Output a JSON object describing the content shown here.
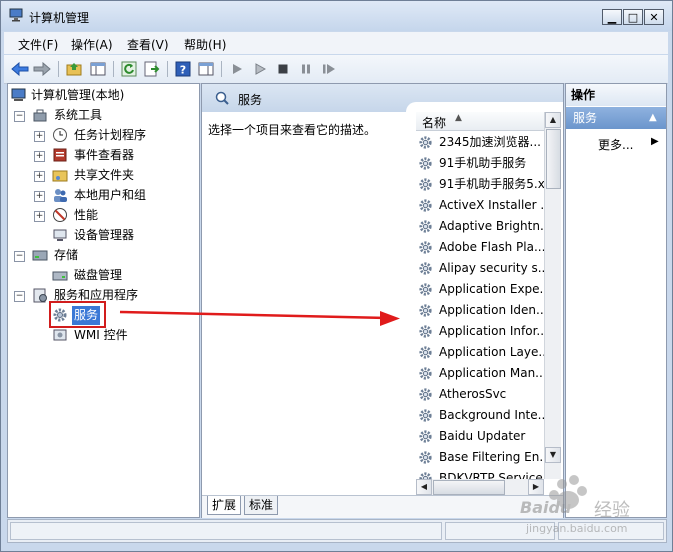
{
  "window": {
    "title": "计算机管理",
    "controls": [
      "minimize",
      "maximize",
      "close"
    ]
  },
  "menu": [
    "文件(F)",
    "操作(A)",
    "查看(V)",
    "帮助(H)"
  ],
  "tree": {
    "root": "计算机管理(本地)",
    "nodes": [
      {
        "label": "系统工具",
        "icon": "tools-icon",
        "expander": "−"
      },
      {
        "label": "任务计划程序",
        "icon": "clock-icon",
        "expander": "+"
      },
      {
        "label": "事件查看器",
        "icon": "event-viewer-icon",
        "expander": "+"
      },
      {
        "label": "共享文件夹",
        "icon": "shared-folder-icon",
        "expander": "+"
      },
      {
        "label": "本地用户和组",
        "icon": "users-icon",
        "expander": "+"
      },
      {
        "label": "性能",
        "icon": "performance-icon",
        "expander": "+"
      },
      {
        "label": "设备管理器",
        "icon": "device-manager-icon",
        "expander": ""
      },
      {
        "label": "存储",
        "icon": "storage-icon",
        "expander": "−"
      },
      {
        "label": "磁盘管理",
        "icon": "disk-icon",
        "expander": ""
      },
      {
        "label": "服务和应用程序",
        "icon": "services-apps-icon",
        "expander": "−"
      },
      {
        "label": "服务",
        "icon": "gear-icon",
        "expander": ""
      },
      {
        "label": "WMI 控件",
        "icon": "wmi-icon",
        "expander": ""
      }
    ]
  },
  "middle": {
    "header_title": "服务",
    "description": "选择一个项目来查看它的描述。",
    "column_name": "名称",
    "services": [
      "2345加速浏览器...",
      "91手机助手服务",
      "91手机助手服务5.x",
      "ActiveX Installer ...",
      "Adaptive Brightn...",
      "Adobe Flash Pla...",
      "Alipay security s...",
      "Application Expe...",
      "Application Iden...",
      "Application Infor...",
      "Application Laye...",
      "Application Man...",
      "AtherosSvc",
      "Background Inte...",
      "Baidu Updater",
      "Base Filtering En...",
      "BDKVRTP Service"
    ],
    "tabs": [
      "扩展",
      "标准"
    ]
  },
  "actions": {
    "title": "操作",
    "section": "服务",
    "more": "更多..."
  },
  "watermark": {
    "brand": "Baidu",
    "text": "经验",
    "url": "jingyan.baidu.com"
  },
  "colors": {
    "accent": "#3a78d6",
    "highlight_red": "#d11d1d",
    "arrow_red": "#e01b1b"
  }
}
